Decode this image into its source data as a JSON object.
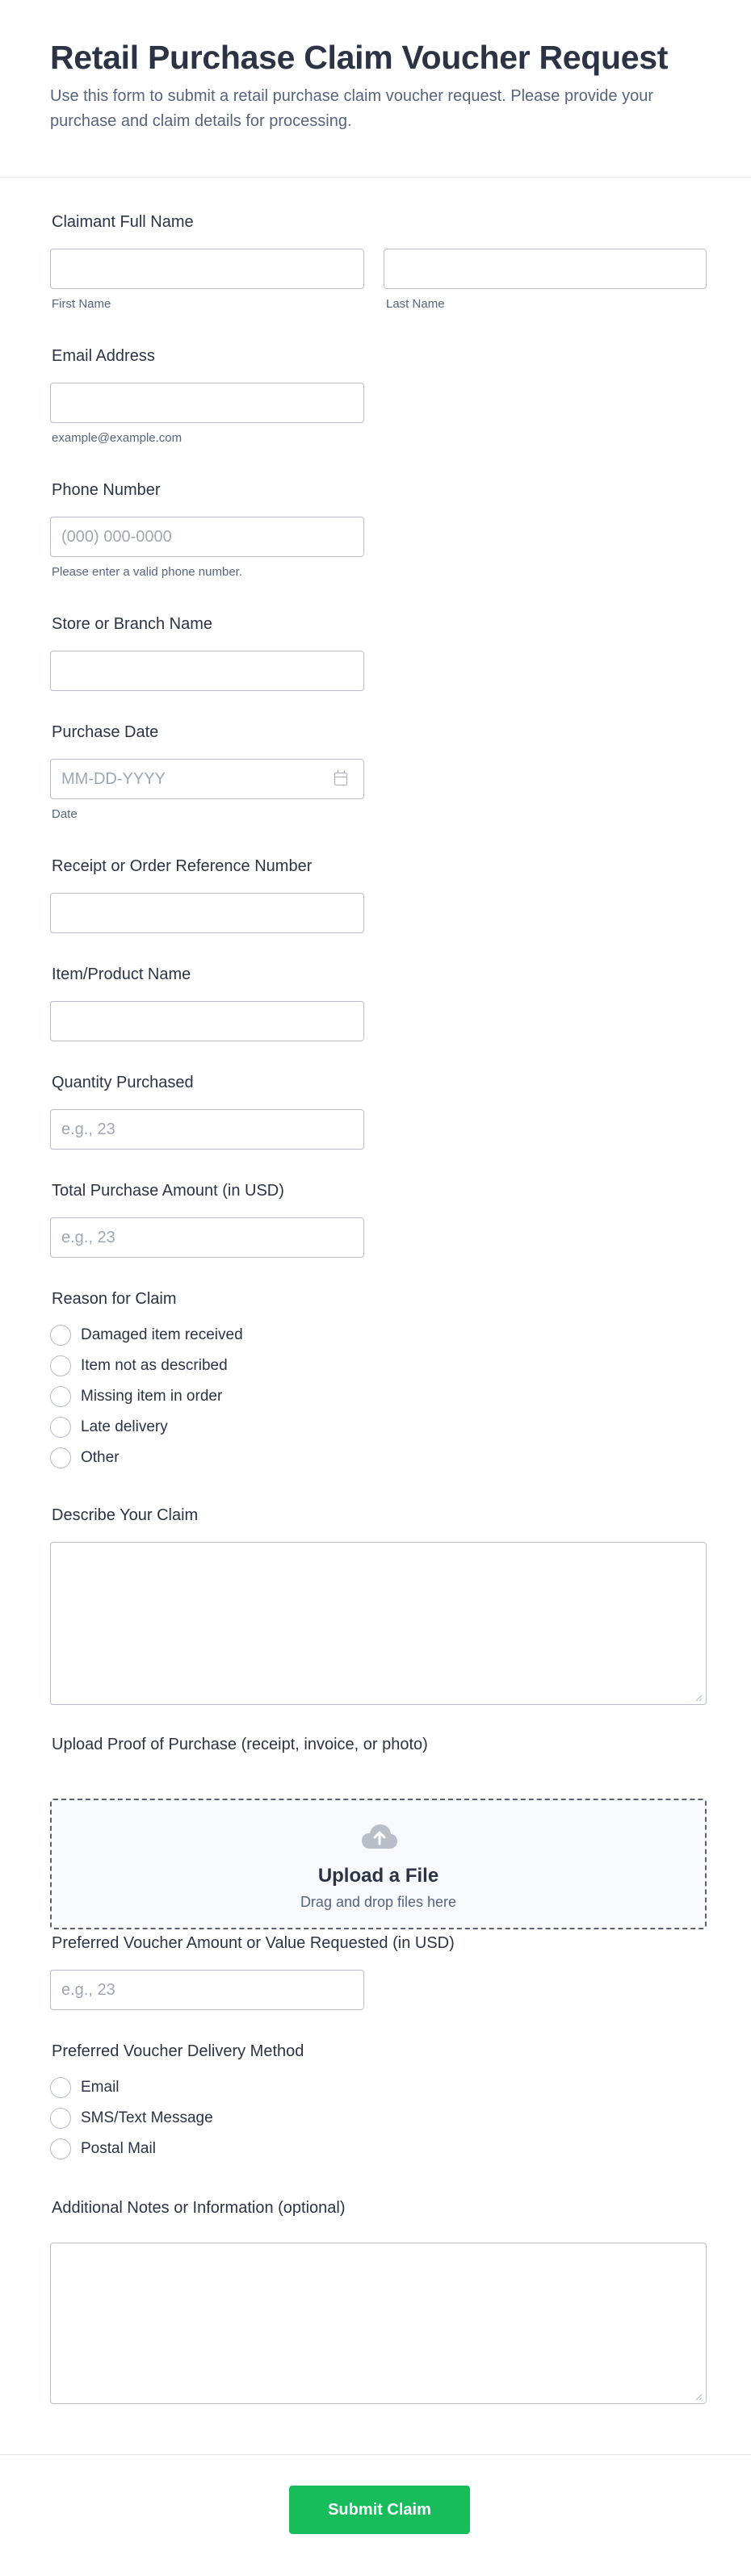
{
  "form": {
    "title": "Retail Purchase Claim Voucher Request",
    "description": "Use this form to submit a retail purchase claim voucher request. Please provide your purchase and claim details for processing."
  },
  "fields": {
    "name": {
      "label": "Claimant Full Name",
      "first_sublabel": "First Name",
      "last_sublabel": "Last Name",
      "first_value": "",
      "last_value": ""
    },
    "email": {
      "label": "Email Address",
      "sublabel": "example@example.com",
      "value": ""
    },
    "phone": {
      "label": "Phone Number",
      "placeholder": "(000) 000-0000",
      "sublabel": "Please enter a valid phone number.",
      "value": ""
    },
    "store": {
      "label": "Store or Branch Name",
      "value": ""
    },
    "date": {
      "label": "Purchase Date",
      "placeholder": "MM-DD-YYYY",
      "sublabel": "Date",
      "value": ""
    },
    "receipt": {
      "label": "Receipt or Order Reference Number",
      "value": ""
    },
    "item": {
      "label": "Item/Product Name",
      "value": ""
    },
    "quantity": {
      "label": "Quantity Purchased",
      "placeholder": "e.g., 23",
      "value": ""
    },
    "total": {
      "label": "Total Purchase Amount (in USD)",
      "placeholder": "e.g., 23",
      "value": ""
    },
    "reason": {
      "label": "Reason for Claim",
      "options": [
        "Damaged item received",
        "Item not as described",
        "Missing item in order",
        "Late delivery",
        "Other"
      ],
      "selected": ""
    },
    "describe": {
      "label": "Describe Your Claim",
      "value": ""
    },
    "upload": {
      "label": "Upload Proof of Purchase (receipt, invoice, or photo)",
      "title": "Upload a File",
      "subtitle": "Drag and drop files here",
      "icon": "cloud-upload-icon"
    },
    "voucher_amount": {
      "label": "Preferred Voucher Amount or Value Requested (in USD)",
      "placeholder": "e.g., 23",
      "value": ""
    },
    "delivery": {
      "label": "Preferred Voucher Delivery Method",
      "options": [
        "Email",
        "SMS/Text Message",
        "Postal Mail"
      ],
      "selected": ""
    },
    "notes": {
      "label": "Additional Notes or Information (optional)",
      "value": ""
    }
  },
  "submit_label": "Submit Claim",
  "colors": {
    "submit": "#18bd5b",
    "text": "#2c3345",
    "muted": "#57647e",
    "border": "#b8bdc9"
  }
}
